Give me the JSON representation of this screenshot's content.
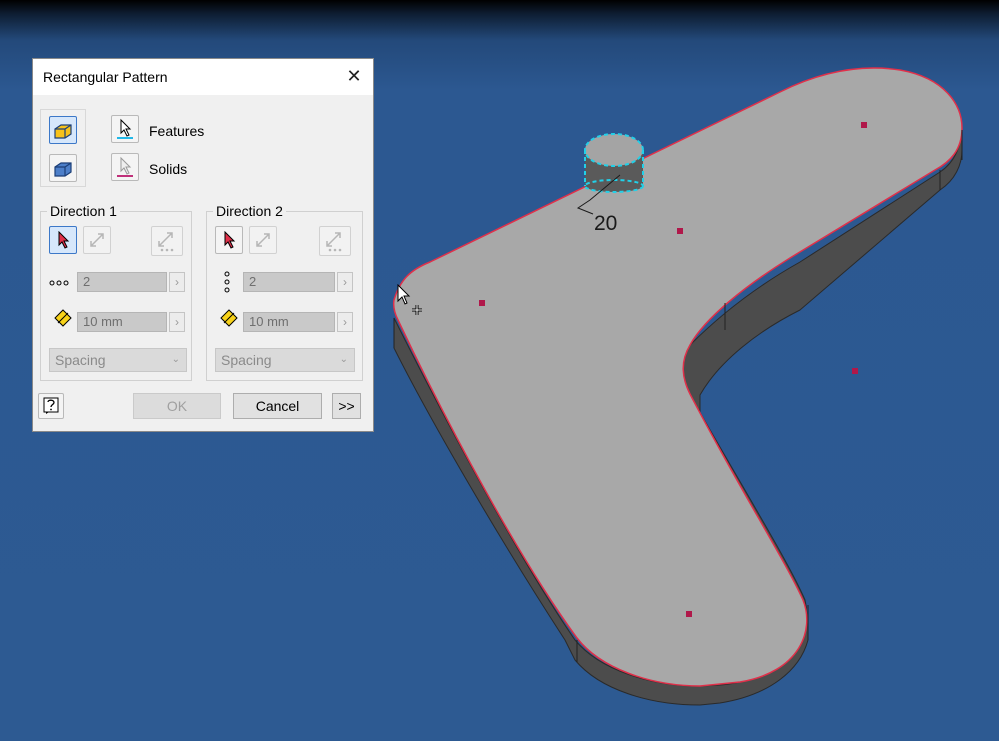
{
  "dialog": {
    "title": "Rectangular Pattern",
    "selection": {
      "features_label": "Features",
      "solids_label": "Solids"
    },
    "direction1": {
      "label": "Direction 1",
      "count": "2",
      "spacing": "10 mm",
      "method": "Spacing"
    },
    "direction2": {
      "label": "Direction 2",
      "count": "2",
      "spacing": "10 mm",
      "method": "Spacing"
    },
    "buttons": {
      "ok": "OK",
      "cancel": "Cancel",
      "more": ">>"
    }
  },
  "viewport": {
    "dimension_label": "20",
    "background_color": "#2d5a92",
    "part_color": "#a8a8a8",
    "edge_highlight_color": "#e0304a",
    "selection_color": "#22d0e8"
  },
  "icons": [
    "pattern-features-mode-icon",
    "pattern-solids-mode-icon",
    "select-arrow-icon",
    "flip-icon",
    "midplane-icon",
    "count-dots-icon",
    "spacing-diamond-icon",
    "help-icon",
    "close-icon",
    "cursor-icon"
  ]
}
